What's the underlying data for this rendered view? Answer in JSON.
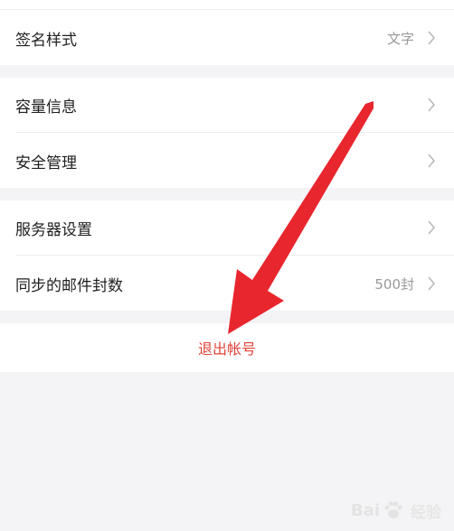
{
  "settings": {
    "group1": [
      {
        "label": "签名样式",
        "value": "文字"
      }
    ],
    "group2": [
      {
        "label": "容量信息",
        "value": ""
      },
      {
        "label": "安全管理",
        "value": ""
      }
    ],
    "group3": [
      {
        "label": "服务器设置",
        "value": ""
      },
      {
        "label": "同步的邮件封数",
        "value": "500封"
      }
    ]
  },
  "logout_label": "退出帐号",
  "watermark": {
    "brand_a": "Bai",
    "brand_b": "",
    "sub": "经验"
  },
  "colors": {
    "background": "#f4f4f6",
    "logout": "#e0443a",
    "arrow": "#e8262e"
  }
}
